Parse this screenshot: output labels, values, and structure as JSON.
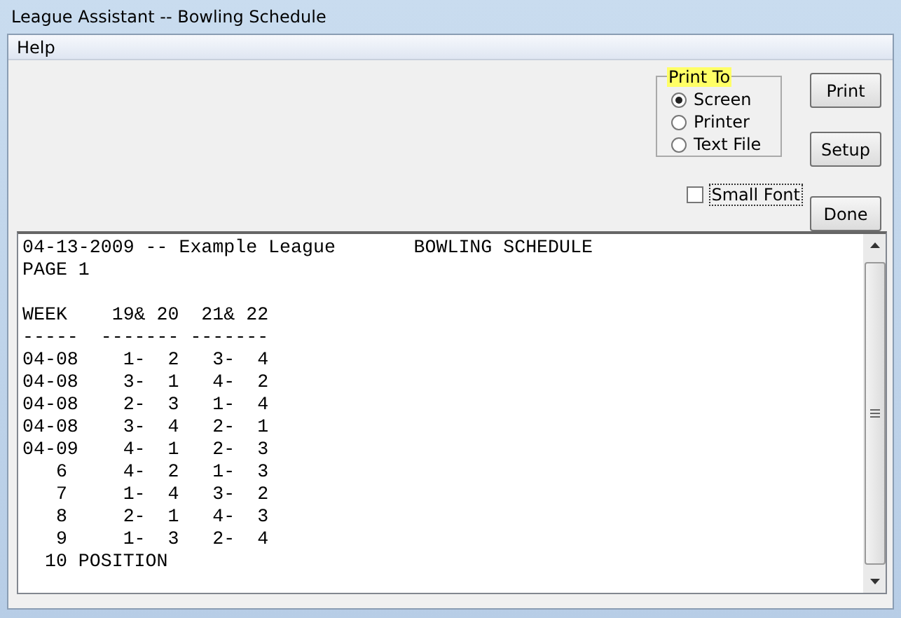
{
  "window": {
    "title": "League Assistant -- Bowling Schedule"
  },
  "menu": [
    "Help"
  ],
  "print_to": {
    "label": "Print To",
    "options": [
      {
        "label": "Screen",
        "selected": true
      },
      {
        "label": "Printer",
        "selected": false
      },
      {
        "label": "Text File",
        "selected": false
      }
    ]
  },
  "small_font": {
    "label": "Small Font",
    "checked": false
  },
  "buttons": [
    "Print",
    "Setup",
    "Done"
  ],
  "report": {
    "header": [
      "04-13-2009 -- Example League       BOWLING SCHEDULE",
      "PAGE 1"
    ],
    "table": [
      "WEEK    19& 20  21& 22",
      "-----  ------- -------",
      "04-08    1-  2   3-  4",
      "04-08    3-  1   4-  2",
      "04-08    2-  3   1-  4",
      "04-08    3-  4   2-  1",
      "04-09    4-  1   2-  3",
      "   6     4-  2   1-  3",
      "   7     1-  4   3-  2",
      "   8     2-  1   4-  3",
      "   9     1-  3   2-  4",
      "  10 POSITION"
    ]
  }
}
